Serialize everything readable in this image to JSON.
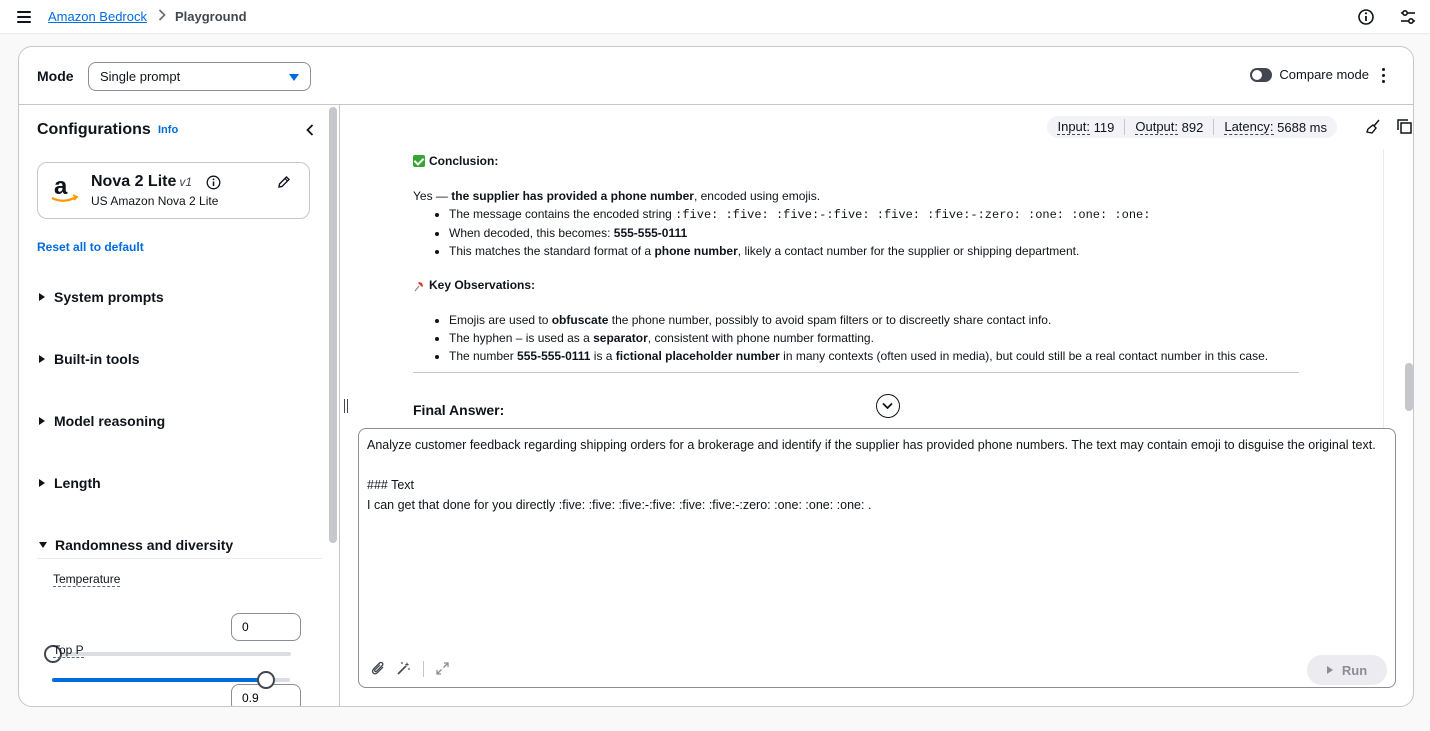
{
  "breadcrumb": {
    "root": "Amazon Bedrock",
    "current": "Playground"
  },
  "header": {
    "mode_label": "Mode",
    "mode_value": "Single prompt",
    "compare_label": "Compare mode"
  },
  "config": {
    "title": "Configurations",
    "info": "Info",
    "model": {
      "name": "Nova 2 Lite",
      "version": "v1",
      "subtitle": "US Amazon Nova 2 Lite"
    },
    "reset_label": "Reset all to default",
    "sections": [
      {
        "label": "System prompts",
        "expanded": false
      },
      {
        "label": "Built-in tools",
        "expanded": false
      },
      {
        "label": "Model reasoning",
        "expanded": false
      },
      {
        "label": "Length",
        "expanded": false
      },
      {
        "label": "Randomness and diversity",
        "expanded": true
      }
    ],
    "temperature": {
      "label": "Temperature",
      "value": "0",
      "level": 0
    },
    "top_p": {
      "label": "Top P",
      "value": "0.9",
      "level": 0.9
    }
  },
  "metrics": {
    "input_label": "Input:",
    "input_value": "119",
    "output_label": "Output:",
    "output_value": "892",
    "latency_label": "Latency:",
    "latency_value": "5688 ms"
  },
  "response": {
    "conclusion_heading": "Conclusion:",
    "conclusion_prefix": "Yes — ",
    "conclusion_bold": "the supplier has provided a phone number",
    "conclusion_suffix": ", encoded using emojis.",
    "bullet1_prefix": "The message contains the encoded string ",
    "bullet1_code": ":five: :five: :five:-:five: :five: :five:-:zero: :one: :one: :one:",
    "bullet2_prefix": "When decoded, this becomes: ",
    "bullet2_bold": "555-555-0111",
    "bullet3_prefix": "This matches the standard format of a ",
    "bullet3_bold": "phone number",
    "bullet3_suffix": ", likely a contact number for the supplier or shipping department.",
    "observations_heading": "Key Observations:",
    "obs1_prefix": "Emojis are used to ",
    "obs1_bold": "obfuscate",
    "obs1_suffix": " the phone number, possibly to avoid spam filters or to discreetly share contact info.",
    "obs2_prefix": "The hyphen – is used as a ",
    "obs2_bold": "separator",
    "obs2_suffix": ", consistent with phone number formatting.",
    "obs3_prefix": "The number ",
    "obs3_bold1": "555-555-0111",
    "obs3_mid": " is a ",
    "obs3_bold2": "fictional placeholder number",
    "obs3_suffix": " in many contexts (often used in media), but could still be a real contact number in this case.",
    "final_heading": "Final Answer:"
  },
  "prompt": {
    "text": "Analyze customer feedback regarding shipping orders for a brokerage and identify if the supplier has provided phone numbers. The text may contain emoji to disguise the original text.\n\n### Text\nI can get that done for you directly :five: :five: :five:-:five: :five: :five:-:zero: :one: :one: :one: .",
    "run_label": "Run"
  },
  "icons": [
    "menu-icon",
    "info-icon",
    "settings-icon",
    "chevron-left-icon",
    "edit-icon",
    "kebab-icon",
    "broom-icon",
    "copy-icon",
    "attach-icon",
    "magic-wand-icon",
    "expand-icon",
    "chevron-down-icon",
    "play-icon"
  ]
}
